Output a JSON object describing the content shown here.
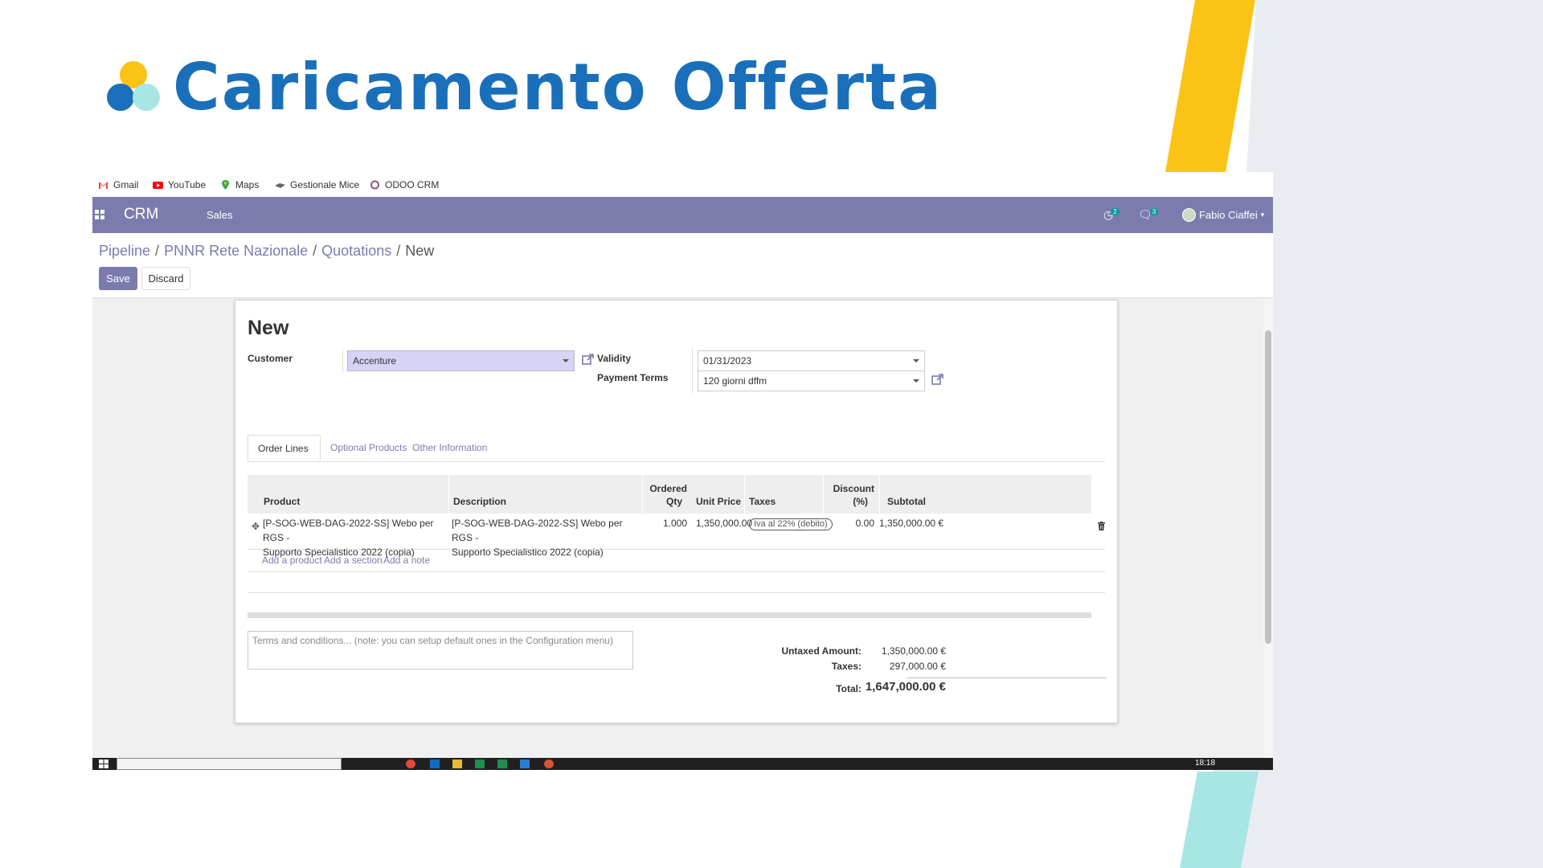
{
  "slide": {
    "title": "Caricamento Offerta",
    "colors": {
      "title": "#1a6fba",
      "yellow": "#fbc315",
      "cyan": "#a8e6e5",
      "gray": "#e9edf2"
    }
  },
  "bookmarks": [
    {
      "label": "Gmail",
      "icon": "gmail-icon"
    },
    {
      "label": "YouTube",
      "icon": "youtube-icon"
    },
    {
      "label": "Maps",
      "icon": "maps-icon"
    },
    {
      "label": "Gestionale Mice",
      "icon": "gestionale-icon"
    },
    {
      "label": "ODOO CRM",
      "icon": "odoo-icon"
    }
  ],
  "navbar": {
    "brand": "CRM",
    "menu": "Sales",
    "activity_count": "2",
    "message_count": "3",
    "user": "Fabio Ciaffei",
    "color": "#7c7bad"
  },
  "breadcrumb": [
    "Pipeline",
    "PNNR Rete Nazionale",
    "Quotations"
  ],
  "breadcrumb_current": "New",
  "buttons": {
    "save": "Save",
    "discard": "Discard"
  },
  "form": {
    "title": "New",
    "customer_label": "Customer",
    "customer_value": "Accenture",
    "validity_label": "Validity",
    "validity_value": "01/31/2023",
    "payment_terms_label": "Payment Terms",
    "payment_terms_value": "120 giorni dffm"
  },
  "tabs": [
    "Order Lines",
    "Optional Products",
    "Other Information"
  ],
  "order_lines": {
    "headers": {
      "product": "Product",
      "description": "Description",
      "ordered": "Ordered",
      "qty": "Qty",
      "unit_price": "Unit Price",
      "taxes": "Taxes",
      "discount": "Discount",
      "discount_unit": "(%)",
      "subtotal": "Subtotal"
    },
    "rows": [
      {
        "product_1": "[P-SOG-WEB-DAG-2022-SS] Webo per RGS -",
        "product_2": "Supporto Specialistico 2022 (copia)",
        "description_1": "[P-SOG-WEB-DAG-2022-SS] Webo per RGS -",
        "description_2": "Supporto Specialistico 2022 (copia)",
        "qty": "1.000",
        "unit_price": "1,350,000.00",
        "taxes": "Iva al 22% (debito)",
        "discount": "0.00",
        "subtotal": "1,350,000.00 €"
      }
    ],
    "add_product": "Add a product",
    "add_section": "Add a section",
    "add_note": "Add a note"
  },
  "terms_placeholder": "Terms and conditions... (note: you can setup default ones in the Configuration menu)",
  "totals": {
    "untaxed_label": "Untaxed Amount:",
    "untaxed_value": "1,350,000.00 €",
    "taxes_label": "Taxes:",
    "taxes_value": "297,000.00 €",
    "total_label": "Total:",
    "total_value": "1,647,000.00 €"
  },
  "taskbar": {
    "clock": "18:18"
  }
}
